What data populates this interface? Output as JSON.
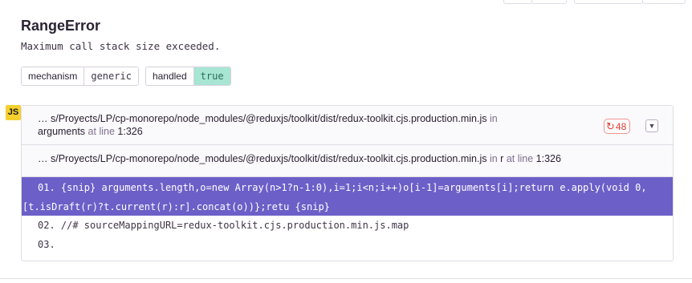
{
  "error": {
    "title": "RangeError",
    "message": "Maximum call stack size exceeded."
  },
  "tags": [
    {
      "key": "mechanism",
      "value": "generic"
    },
    {
      "key": "handled",
      "value": "true"
    }
  ],
  "platform_badge": "JS",
  "frames": [
    {
      "path": "… s/Proyects/LP/cp-monorepo/node_modules/@reduxjs/toolkit/dist/redux-toolkit.cjs.production.min.js",
      "in_label": "in",
      "function": "arguments",
      "at_line_label": "at line",
      "line": "1:326",
      "repeat_count": "48",
      "repeat_icon": "refresh-icon",
      "toggle_icon": "chevron-down-icon"
    },
    {
      "path": "… s/Proyects/LP/cp-monorepo/node_modules/@reduxjs/toolkit/dist/redux-toolkit.cjs.production.min.js",
      "in_label": "in",
      "function": "r",
      "at_line_label": "at line",
      "line": "1:326",
      "toggle_icon": "chevron-up-icon"
    }
  ],
  "context": {
    "active_line_a": "01. {snip} arguments.length,o=new Array(n>1?n-1:0),i=1;i<n;i++)o[i-1]=arguments[i];return e.apply(void 0,",
    "active_line_b": "[t.isDraft(r)?t.current(r):r].concat(o))};retu {snip}",
    "line2": "02. //# sourceMappingURL=redux-toolkit.cjs.production.min.js.map",
    "line3": "03."
  },
  "colors": {
    "accent": "#6c5fc7",
    "handled_true_bg": "#a8e6d4",
    "repeat_badge": "#e03e2f",
    "js_badge": "#f5d02e"
  }
}
